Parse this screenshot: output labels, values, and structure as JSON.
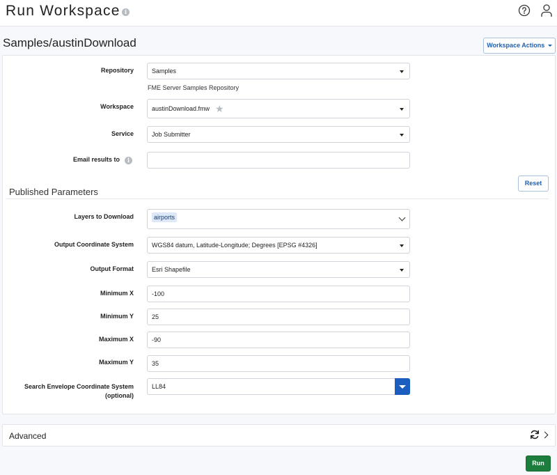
{
  "header": {
    "title": "Run Workspace",
    "info_icon": "info-icon",
    "help_icon": "help-circle-icon",
    "user_icon": "user-icon"
  },
  "workspace_path": "Samples/austinDownload",
  "actions_button": {
    "label": "Workspace Actions"
  },
  "form": {
    "repository": {
      "label": "Repository",
      "value": "Samples",
      "helper": "FME Server Samples Repository"
    },
    "workspace": {
      "label": "Workspace",
      "value": "austinDownload.fmw"
    },
    "service": {
      "label": "Service",
      "value": "Job Submitter"
    },
    "email": {
      "label": "Email results to",
      "value": ""
    }
  },
  "reset_button": {
    "label": "Reset"
  },
  "published_parameters": {
    "title": "Published Parameters",
    "layers": {
      "label": "Layers to Download",
      "value": "airports"
    },
    "output_cs": {
      "label": "Output Coordinate System",
      "value": "WGS84 datum, Latitude-Longitude; Degrees [EPSG #4326]"
    },
    "output_format": {
      "label": "Output Format",
      "value": "Esri Shapefile"
    },
    "min_x": {
      "label": "Minimum X",
      "value": "-100"
    },
    "min_y": {
      "label": "Minimum Y",
      "value": "25"
    },
    "max_x": {
      "label": "Maximum X",
      "value": "-90"
    },
    "max_y": {
      "label": "Maximum Y",
      "value": "35"
    },
    "search_cs": {
      "label_line1": "Search Envelope Coordinate System",
      "label_line2": "(optional)",
      "value": "LL84"
    }
  },
  "advanced": {
    "label": "Advanced"
  },
  "run_button": {
    "label": "Run"
  },
  "colors": {
    "accent": "#1b5ebf",
    "run": "#1d7d3c",
    "link": "#1f5fb0"
  }
}
